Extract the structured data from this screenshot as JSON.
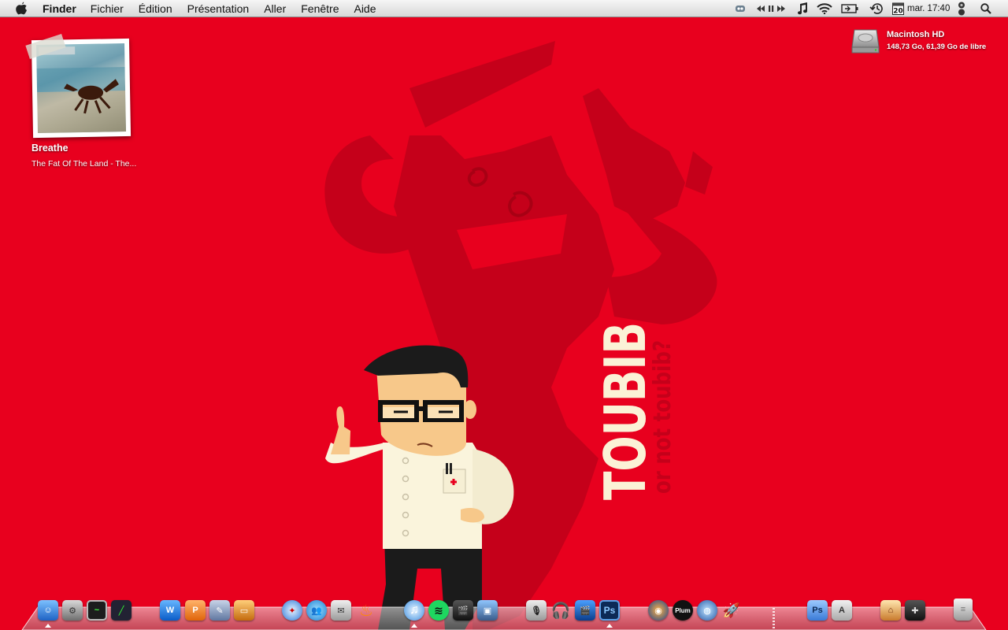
{
  "menubar": {
    "app_name": "Finder",
    "menus": [
      "Fichier",
      "Édition",
      "Présentation",
      "Aller",
      "Fenêtre",
      "Aide"
    ],
    "calendar_day": "20",
    "clock": "mar. 17:40"
  },
  "wallpaper": {
    "title": "TOUBIB",
    "subtitle": "or not toubib?"
  },
  "desktop": {
    "now_playing": {
      "title": "Breathe",
      "subtitle": "The Fat Of The Land - The..."
    },
    "volume": {
      "name": "Macintosh HD",
      "info": "148,73 Go, 61,39 Go de libre"
    }
  },
  "dock": {
    "photoshop_label": "Ps",
    "photoshop_folder_label": "Ps",
    "plum_label": "Plum"
  }
}
